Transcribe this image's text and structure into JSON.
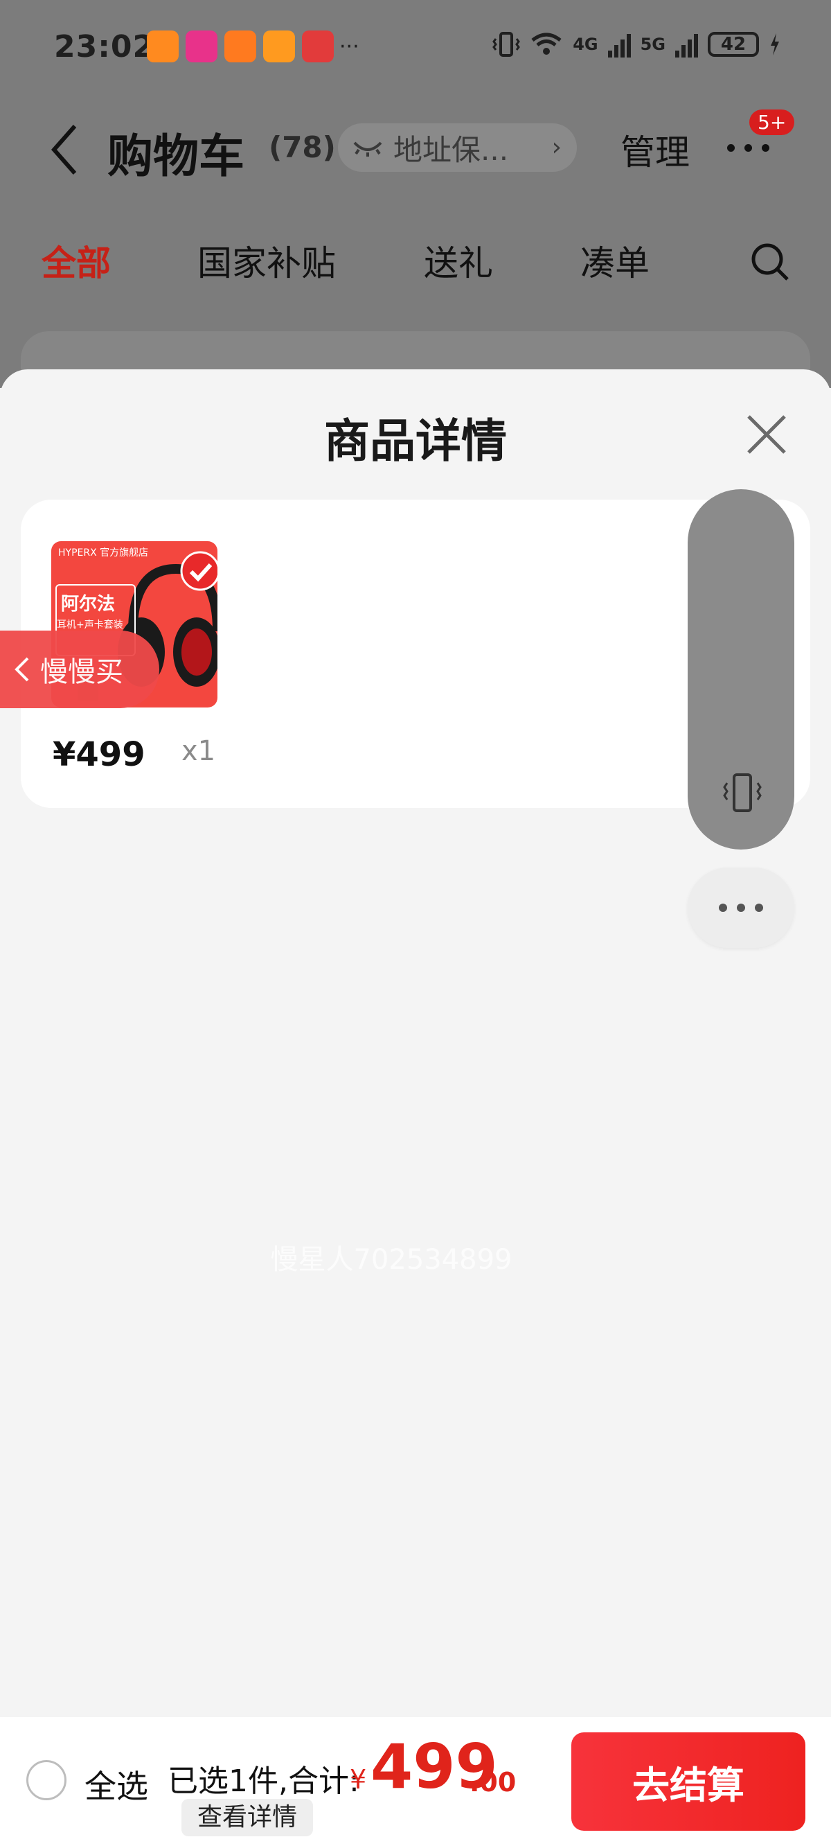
{
  "status_bar": {
    "time": "23:02",
    "more": "···",
    "net_4g": "4G",
    "net_5g": "5G",
    "battery": "42"
  },
  "header": {
    "title": "购物车",
    "count": "(78)",
    "address": "地址保...",
    "manage": "管理",
    "badge": "5+"
  },
  "tabs": [
    {
      "label": "全部"
    },
    {
      "label": "国家补贴"
    },
    {
      "label": "送礼"
    },
    {
      "label": "凑单"
    }
  ],
  "sheet": {
    "title": "商品详情",
    "product": {
      "brand_line": "HYPERX 官方旗舰店",
      "image_name": "阿尔法",
      "image_sub": "耳机+声卡套装",
      "price": "¥499",
      "quantity": "x1"
    },
    "watermark": "慢星人702534899"
  },
  "slow_buy": {
    "label": "慢慢买"
  },
  "bottom_bar": {
    "select_all": "全选",
    "summary": "已选1件,合计:",
    "currency": "¥",
    "amount": "499",
    "cents": ".00",
    "view_detail": "查看详情",
    "checkout": "去结算"
  },
  "colors": {
    "accent": "#e0241b",
    "dim": "#7c7c7c",
    "sheet_bg": "#f4f4f4"
  }
}
